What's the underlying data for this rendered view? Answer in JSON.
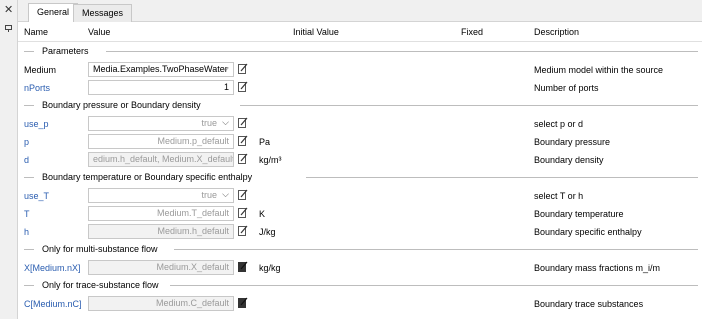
{
  "side": {
    "close_glyph": "✕"
  },
  "tabs": [
    {
      "label": "General",
      "active": true
    },
    {
      "label": "Messages",
      "active": false
    }
  ],
  "columns": {
    "name": "Name",
    "value": "Value",
    "initial": "Initial Value",
    "fixed": "Fixed",
    "description": "Description"
  },
  "groups": {
    "parameters": "Parameters",
    "pressure_density": "Boundary pressure or Boundary density",
    "temperature_enthalpy": "Boundary temperature or Boundary specific enthalpy",
    "multi_substance": "Only for multi-substance flow",
    "trace_substance": "Only for trace-substance flow"
  },
  "rows": {
    "medium": {
      "name": "Medium",
      "value": "Media.Examples.TwoPhaseWater",
      "unit": "",
      "description": "Medium model within the source"
    },
    "nPorts": {
      "name": "nPorts",
      "value": "1",
      "unit": "",
      "description": "Number of ports"
    },
    "use_p": {
      "name": "use_p",
      "value": "true",
      "unit": "",
      "description": "select p or d"
    },
    "p": {
      "name": "p",
      "value": "Medium.p_default",
      "unit": "Pa",
      "description": "Boundary pressure"
    },
    "d": {
      "name": "d",
      "value": "edium.h_default, Medium.X_default)",
      "unit": "kg/m³",
      "description": "Boundary density"
    },
    "use_T": {
      "name": "use_T",
      "value": "true",
      "unit": "",
      "description": "select T or h"
    },
    "T": {
      "name": "T",
      "value": "Medium.T_default",
      "unit": "K",
      "description": "Boundary temperature"
    },
    "h": {
      "name": "h",
      "value": "Medium.h_default",
      "unit": "J/kg",
      "description": "Boundary specific enthalpy"
    },
    "X": {
      "name": "X[Medium.nX]",
      "value": "Medium.X_default",
      "unit": "kg/kg",
      "description": "Boundary mass fractions m_i/m"
    },
    "C": {
      "name": "C[Medium.nC]",
      "value": "Medium.C_default",
      "unit": "",
      "description": "Boundary trace substances"
    }
  },
  "colors": {
    "param_blue": "#2a5db0",
    "disabled_text": "#9a9a9a"
  }
}
